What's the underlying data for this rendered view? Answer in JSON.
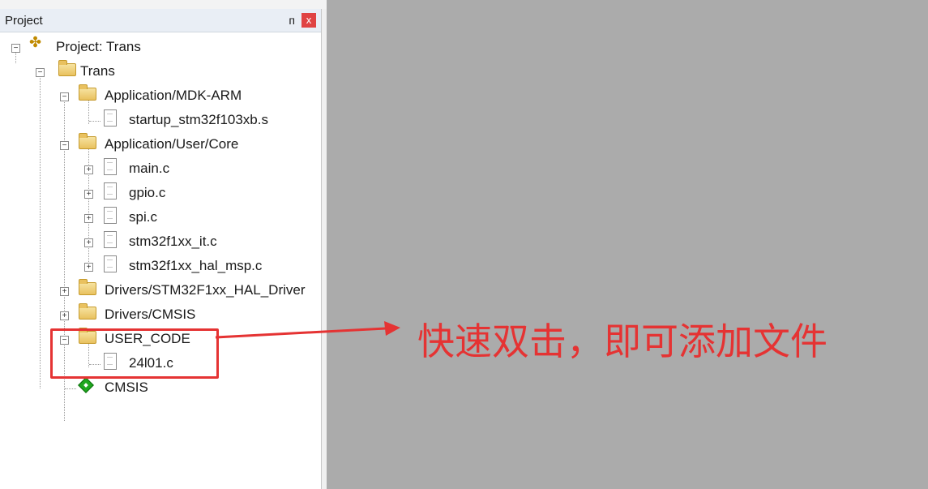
{
  "panel": {
    "title": "Project",
    "pin_glyph": "ᴨ",
    "close_glyph": "x"
  },
  "tree": {
    "root": "Project: Trans",
    "target": "Trans",
    "groups": [
      {
        "label": "Application/MDK-ARM",
        "files": [
          "startup_stm32f103xb.s"
        ]
      },
      {
        "label": "Application/User/Core",
        "files": [
          "main.c",
          "gpio.c",
          "spi.c",
          "stm32f1xx_it.c",
          "stm32f1xx_hal_msp.c"
        ]
      },
      {
        "label": "Drivers/STM32F1xx_HAL_Driver",
        "files": []
      },
      {
        "label": "Drivers/CMSIS",
        "files": []
      },
      {
        "label": "USER_CODE",
        "files": [
          "24l01.c"
        ]
      }
    ],
    "cmsis": "CMSIS"
  },
  "annotation": {
    "text": "快速双击，即可添加文件",
    "color": "#e53333"
  },
  "icons": {
    "project": "project-icon",
    "folder": "folder-icon",
    "file": "file-icon",
    "cmsis": "cmsis-component-icon"
  }
}
